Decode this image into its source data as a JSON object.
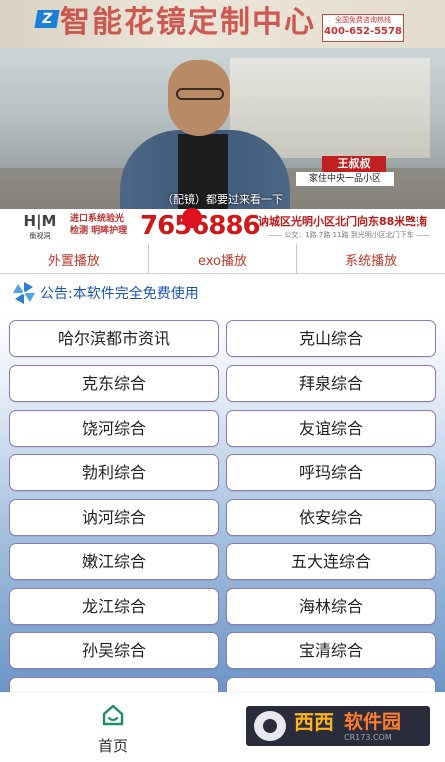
{
  "video": {
    "shop_sign": "智能花镜定制中心",
    "brand_logo": "Z",
    "hotline_label": "全国免费咨询热线",
    "hotline": "400-652-5578",
    "person_name": "王叔叔",
    "person_desc": "家住中央一品小区",
    "subtitle": "（配镜）都要过来看一下",
    "bottom_brand": "衡视洞",
    "bottom_tag_line1": "进口系统验光",
    "bottom_tag_line2": "检测 明眸护理",
    "bottom_phone": "7656886",
    "bottom_address": "讷城区光明小区北门向东88米路南",
    "bottom_address_sub": "—— 公交：1路 7路 11路 到光明小区北门下车 ——"
  },
  "tabs": [
    "外置播放",
    "exo播放",
    "系统播放"
  ],
  "notice": {
    "icon": "pinwheel-icon",
    "text": "公告:本软件完全免费使用"
  },
  "channels": [
    "哈尔滨都市资讯",
    "克山综合",
    "克东综合",
    "拜泉综合",
    "饶河综合",
    "友谊综合",
    "勃利综合",
    "呼玛综合",
    "讷河综合",
    "依安综合",
    "嫩江综合",
    "五大连综合",
    "龙江综合",
    "海林综合",
    "孙吴综合",
    "宝清综合"
  ],
  "nav": {
    "home_label": "首页",
    "home_icon": "home-icon",
    "watermark_main_1": "西西",
    "watermark_main_2": "软件园",
    "watermark_url": "CR173.COM"
  },
  "colors": {
    "tab_text": "#c0392b",
    "notice_text": "#1a56b8",
    "channel_border": "#8c7bb8",
    "home_icon": "#1f8f5f"
  }
}
